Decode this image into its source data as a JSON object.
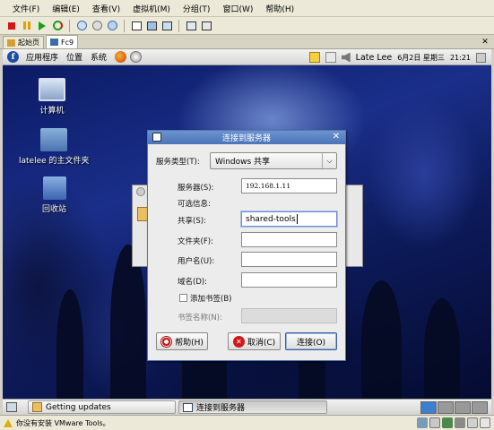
{
  "vm_menubar": {
    "items": [
      "文件(F)",
      "编辑(E)",
      "查看(V)",
      "虚拟机(M)",
      "分组(T)",
      "窗口(W)",
      "帮助(H)"
    ]
  },
  "vm_tabs": [
    {
      "label": "起始页",
      "active": false
    },
    {
      "label": "Fc9",
      "active": true
    }
  ],
  "gnome_panel": {
    "menus": [
      "应用程序",
      "位置",
      "系统"
    ],
    "user": "Late Lee",
    "date": "6月2日 星期三",
    "time": "21:21"
  },
  "desktop_icons": [
    {
      "label": "计算机"
    },
    {
      "label": "latelee 的主文件夹"
    },
    {
      "label": "回收站"
    }
  ],
  "dialog": {
    "title": "连接到服务器",
    "service_type_label": "服务类型(T):",
    "service_type_value": "Windows 共享",
    "server_label": "服务器(S):",
    "server_value": "192.168.1.11",
    "optional_info": "可选信息:",
    "share_label": "共享(S):",
    "share_value": "shared-tools",
    "folder_label": "文件夹(F):",
    "folder_value": "",
    "username_label": "用户名(U):",
    "username_value": "",
    "domain_label": "域名(D):",
    "domain_value": "",
    "bookmark_checkbox": "添加书签(B)",
    "bookmark_checked": false,
    "bookmark_name_label": "书签名称(N):",
    "help_button": "帮助(H)",
    "cancel_button": "取消(C)",
    "connect_button": "连接(O)"
  },
  "taskbar": {
    "tasks": [
      {
        "label": "Getting updates",
        "active": false
      },
      {
        "label": "连接到服务器",
        "active": true
      }
    ]
  },
  "vm_status": {
    "text": "你没有安装 VMware Tools。"
  },
  "colors": {
    "title_bar": "#4a74b8",
    "desktop": "#0b1a64",
    "workspace_active": "#3a7fd0"
  }
}
